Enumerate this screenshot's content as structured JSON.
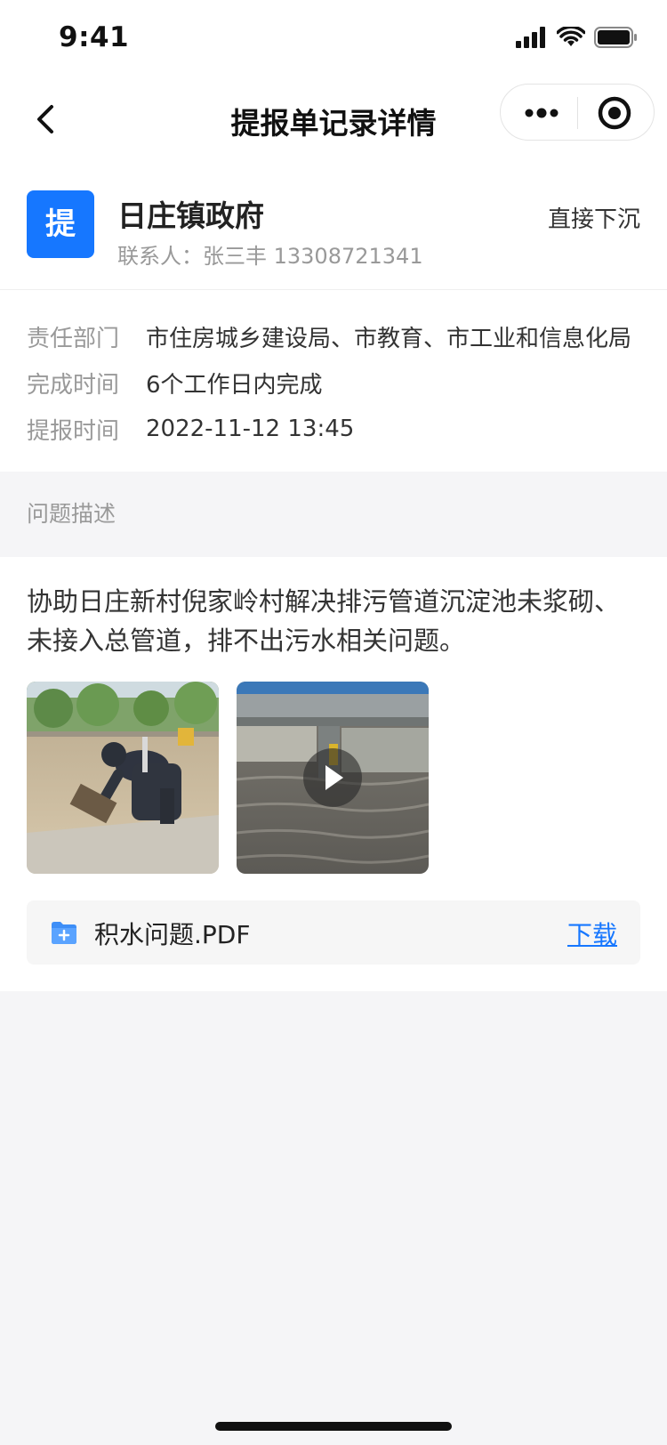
{
  "status": {
    "time": "9:41"
  },
  "nav": {
    "title": "提报单记录详情"
  },
  "org": {
    "badge": "提",
    "name": "日庄镇政府",
    "contact": "联系人：张三丰 13308721341",
    "tag": "直接下沉"
  },
  "info": {
    "rows": [
      {
        "label": "责任部门",
        "value": "市住房城乡建设局、市教育、市工业和信息化局"
      },
      {
        "label": "完成时间",
        "value": "6个工作日内完成"
      },
      {
        "label": "提报时间",
        "value": "2022-11-12 13:45"
      }
    ]
  },
  "section": {
    "title": "问题描述"
  },
  "content": {
    "description": "协助日庄新村倪家岭村解决排污管道沉淀池未浆砌、未接入总管道，排不出污水相关问题。",
    "file_name": "积水问题.PDF",
    "download_label": "下载"
  },
  "icons": {
    "back": "chevron-left-icon",
    "more": "more-dots-icon",
    "close": "target-circle-icon",
    "file": "folder-icon",
    "play": "play-icon"
  },
  "colors": {
    "accent": "#1677ff",
    "page_bg": "#f5f5f7"
  }
}
